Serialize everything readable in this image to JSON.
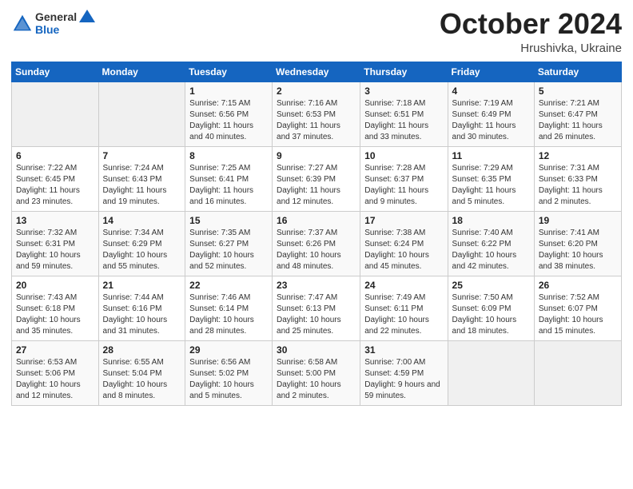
{
  "header": {
    "logo_general": "General",
    "logo_blue": "Blue",
    "title": "October 2024",
    "location": "Hrushivka, Ukraine"
  },
  "days_of_week": [
    "Sunday",
    "Monday",
    "Tuesday",
    "Wednesday",
    "Thursday",
    "Friday",
    "Saturday"
  ],
  "weeks": [
    [
      {
        "day": "",
        "info": ""
      },
      {
        "day": "",
        "info": ""
      },
      {
        "day": "1",
        "info": "Sunrise: 7:15 AM\nSunset: 6:56 PM\nDaylight: 11 hours and 40 minutes."
      },
      {
        "day": "2",
        "info": "Sunrise: 7:16 AM\nSunset: 6:53 PM\nDaylight: 11 hours and 37 minutes."
      },
      {
        "day": "3",
        "info": "Sunrise: 7:18 AM\nSunset: 6:51 PM\nDaylight: 11 hours and 33 minutes."
      },
      {
        "day": "4",
        "info": "Sunrise: 7:19 AM\nSunset: 6:49 PM\nDaylight: 11 hours and 30 minutes."
      },
      {
        "day": "5",
        "info": "Sunrise: 7:21 AM\nSunset: 6:47 PM\nDaylight: 11 hours and 26 minutes."
      }
    ],
    [
      {
        "day": "6",
        "info": "Sunrise: 7:22 AM\nSunset: 6:45 PM\nDaylight: 11 hours and 23 minutes."
      },
      {
        "day": "7",
        "info": "Sunrise: 7:24 AM\nSunset: 6:43 PM\nDaylight: 11 hours and 19 minutes."
      },
      {
        "day": "8",
        "info": "Sunrise: 7:25 AM\nSunset: 6:41 PM\nDaylight: 11 hours and 16 minutes."
      },
      {
        "day": "9",
        "info": "Sunrise: 7:27 AM\nSunset: 6:39 PM\nDaylight: 11 hours and 12 minutes."
      },
      {
        "day": "10",
        "info": "Sunrise: 7:28 AM\nSunset: 6:37 PM\nDaylight: 11 hours and 9 minutes."
      },
      {
        "day": "11",
        "info": "Sunrise: 7:29 AM\nSunset: 6:35 PM\nDaylight: 11 hours and 5 minutes."
      },
      {
        "day": "12",
        "info": "Sunrise: 7:31 AM\nSunset: 6:33 PM\nDaylight: 11 hours and 2 minutes."
      }
    ],
    [
      {
        "day": "13",
        "info": "Sunrise: 7:32 AM\nSunset: 6:31 PM\nDaylight: 10 hours and 59 minutes."
      },
      {
        "day": "14",
        "info": "Sunrise: 7:34 AM\nSunset: 6:29 PM\nDaylight: 10 hours and 55 minutes."
      },
      {
        "day": "15",
        "info": "Sunrise: 7:35 AM\nSunset: 6:27 PM\nDaylight: 10 hours and 52 minutes."
      },
      {
        "day": "16",
        "info": "Sunrise: 7:37 AM\nSunset: 6:26 PM\nDaylight: 10 hours and 48 minutes."
      },
      {
        "day": "17",
        "info": "Sunrise: 7:38 AM\nSunset: 6:24 PM\nDaylight: 10 hours and 45 minutes."
      },
      {
        "day": "18",
        "info": "Sunrise: 7:40 AM\nSunset: 6:22 PM\nDaylight: 10 hours and 42 minutes."
      },
      {
        "day": "19",
        "info": "Sunrise: 7:41 AM\nSunset: 6:20 PM\nDaylight: 10 hours and 38 minutes."
      }
    ],
    [
      {
        "day": "20",
        "info": "Sunrise: 7:43 AM\nSunset: 6:18 PM\nDaylight: 10 hours and 35 minutes."
      },
      {
        "day": "21",
        "info": "Sunrise: 7:44 AM\nSunset: 6:16 PM\nDaylight: 10 hours and 31 minutes."
      },
      {
        "day": "22",
        "info": "Sunrise: 7:46 AM\nSunset: 6:14 PM\nDaylight: 10 hours and 28 minutes."
      },
      {
        "day": "23",
        "info": "Sunrise: 7:47 AM\nSunset: 6:13 PM\nDaylight: 10 hours and 25 minutes."
      },
      {
        "day": "24",
        "info": "Sunrise: 7:49 AM\nSunset: 6:11 PM\nDaylight: 10 hours and 22 minutes."
      },
      {
        "day": "25",
        "info": "Sunrise: 7:50 AM\nSunset: 6:09 PM\nDaylight: 10 hours and 18 minutes."
      },
      {
        "day": "26",
        "info": "Sunrise: 7:52 AM\nSunset: 6:07 PM\nDaylight: 10 hours and 15 minutes."
      }
    ],
    [
      {
        "day": "27",
        "info": "Sunrise: 6:53 AM\nSunset: 5:06 PM\nDaylight: 10 hours and 12 minutes."
      },
      {
        "day": "28",
        "info": "Sunrise: 6:55 AM\nSunset: 5:04 PM\nDaylight: 10 hours and 8 minutes."
      },
      {
        "day": "29",
        "info": "Sunrise: 6:56 AM\nSunset: 5:02 PM\nDaylight: 10 hours and 5 minutes."
      },
      {
        "day": "30",
        "info": "Sunrise: 6:58 AM\nSunset: 5:00 PM\nDaylight: 10 hours and 2 minutes."
      },
      {
        "day": "31",
        "info": "Sunrise: 7:00 AM\nSunset: 4:59 PM\nDaylight: 9 hours and 59 minutes."
      },
      {
        "day": "",
        "info": ""
      },
      {
        "day": "",
        "info": ""
      }
    ]
  ]
}
